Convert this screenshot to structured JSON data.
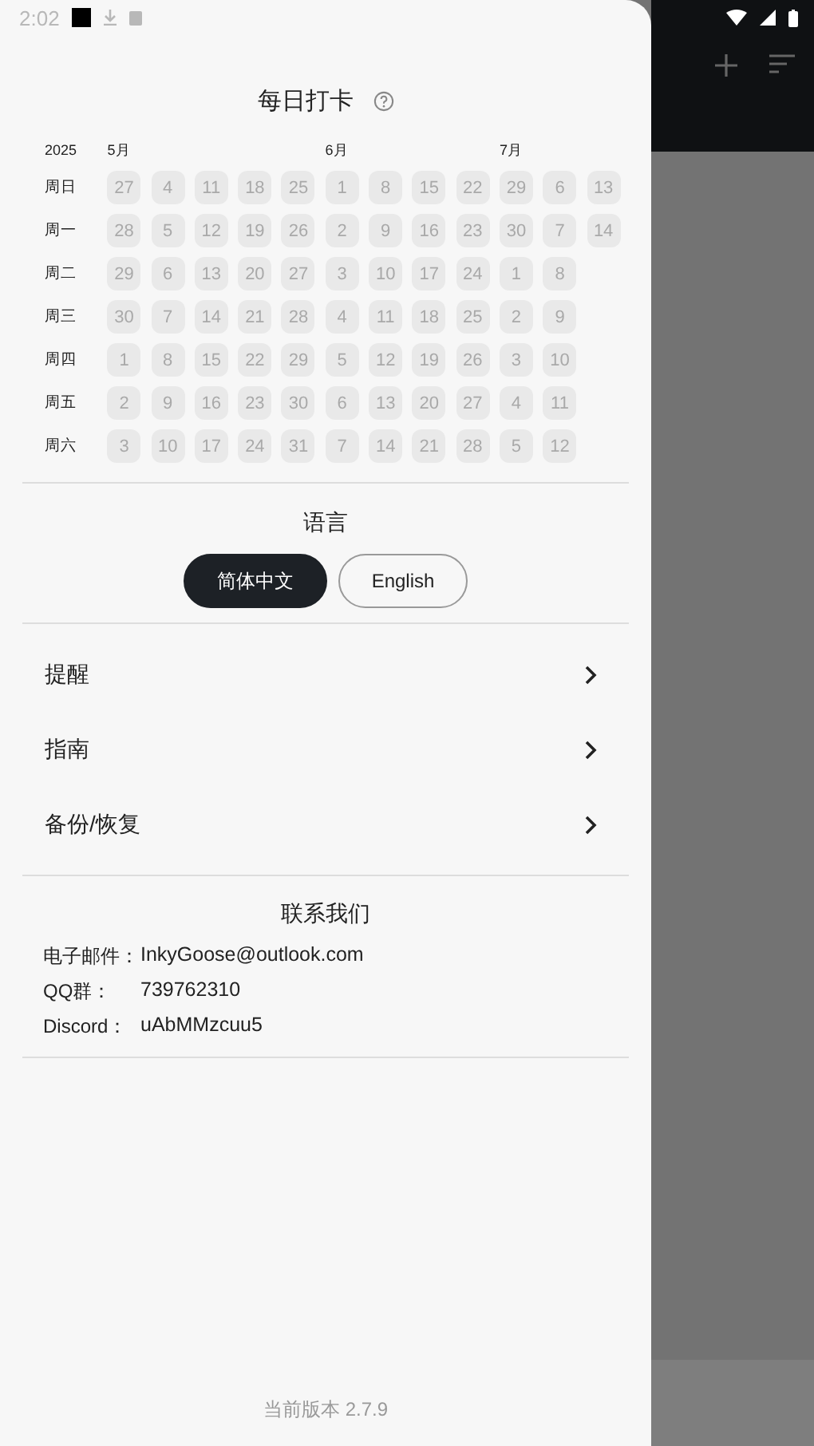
{
  "status_bar": {
    "time": "2:02"
  },
  "drawer": {
    "checkin": {
      "title": "每日打卡",
      "year": "2025",
      "weekdays": [
        "周日",
        "周一",
        "周二",
        "周三",
        "周四",
        "周五",
        "周六"
      ],
      "weeks": [
        {
          "month_label": "5月",
          "days": [
            "27",
            "28",
            "29",
            "30",
            "1",
            "2",
            "3"
          ]
        },
        {
          "days": [
            "4",
            "5",
            "6",
            "7",
            "8",
            "9",
            "10"
          ]
        },
        {
          "days": [
            "11",
            "12",
            "13",
            "14",
            "15",
            "16",
            "17"
          ]
        },
        {
          "days": [
            "18",
            "19",
            "20",
            "21",
            "22",
            "23",
            "24"
          ]
        },
        {
          "days": [
            "25",
            "26",
            "27",
            "28",
            "29",
            "30",
            "31"
          ]
        },
        {
          "month_label": "6月",
          "days": [
            "1",
            "2",
            "3",
            "4",
            "5",
            "6",
            "7"
          ]
        },
        {
          "days": [
            "8",
            "9",
            "10",
            "11",
            "12",
            "13",
            "14"
          ]
        },
        {
          "days": [
            "15",
            "16",
            "17",
            "18",
            "19",
            "20",
            "21"
          ]
        },
        {
          "days": [
            "22",
            "23",
            "24",
            "25",
            "26",
            "27",
            "28"
          ]
        },
        {
          "month_label": "7月",
          "days": [
            "29",
            "30",
            "1",
            "2",
            "3",
            "4",
            "5"
          ]
        },
        {
          "days": [
            "6",
            "7",
            "8",
            "9",
            "10",
            "11",
            "12"
          ]
        },
        {
          "days": [
            "13",
            "14"
          ]
        }
      ]
    },
    "language": {
      "title": "语言",
      "options": [
        {
          "label": "简体中文",
          "selected": true
        },
        {
          "label": "English",
          "selected": false
        }
      ]
    },
    "menu": [
      {
        "label": "提醒"
      },
      {
        "label": "指南"
      },
      {
        "label": "备份/恢复"
      }
    ],
    "contact": {
      "title": "联系我们",
      "rows": [
        {
          "label": "电子邮件：",
          "value": "InkyGoose@outlook.com"
        },
        {
          "label": "QQ群：",
          "value": "739762310"
        },
        {
          "label": "Discord：",
          "value": "uAbMMzcuu5"
        }
      ]
    },
    "version": "当前版本 2.7.9"
  }
}
